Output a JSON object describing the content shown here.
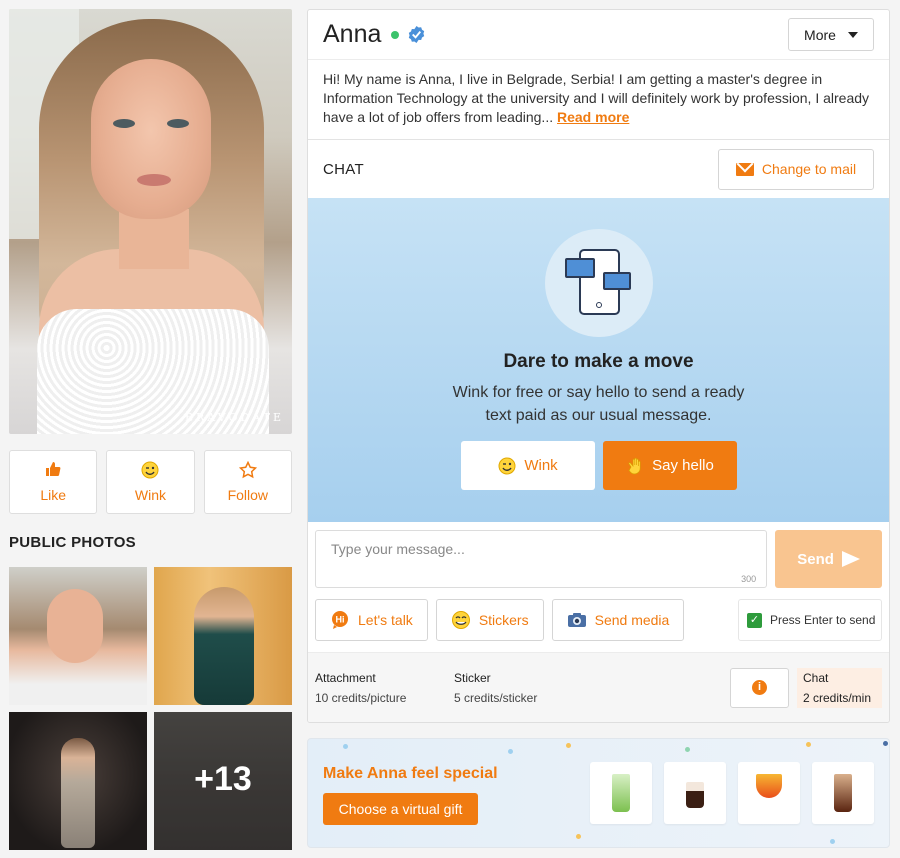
{
  "profile": {
    "name": "Anna",
    "watermark": "BRAVODATE",
    "more_label": "More",
    "bio": "Hi! My name is Anna, I live in Belgrade, Serbia! I am getting a master's degree in Information Technology at the university and I will definitely work by profession, I already have a lot of job offers from leading...",
    "read_more": "Read more"
  },
  "actions": [
    {
      "label": "Like",
      "icon": "thumbs-up-icon"
    },
    {
      "label": "Wink",
      "icon": "wink-smiley-icon"
    },
    {
      "label": "Follow",
      "icon": "star-icon"
    }
  ],
  "photos": {
    "title": "PUBLIC PHOTOS",
    "more_count": "+13"
  },
  "chat": {
    "title": "CHAT",
    "change_mail": "Change to mail",
    "hero_title": "Dare to make a move",
    "hero_text": "Wink for free or say hello to send a ready text paid as our usual message.",
    "wink": "Wink",
    "say_hello": "Say hello",
    "placeholder": "Type your message...",
    "char_limit": "300",
    "send": "Send",
    "tools": [
      {
        "label": "Let's talk",
        "icon": "hi-bubble-icon"
      },
      {
        "label": "Stickers",
        "icon": "emoji-icon"
      },
      {
        "label": "Send media",
        "icon": "camera-icon"
      }
    ],
    "press_enter": "Press Enter to send",
    "press_enter_checked": true
  },
  "credits": {
    "attachment_label": "Attachment",
    "attachment_value": "10 credits/picture",
    "sticker_label": "Sticker",
    "sticker_value": "5 credits/sticker",
    "chat_label": "Chat",
    "chat_value": "2 credits/min"
  },
  "gift": {
    "title": "Make Anna feel special",
    "button": "Choose a virtual gift",
    "items": [
      "mojito-gift",
      "coffee-gift",
      "cocktail-gift",
      "cola-gift"
    ]
  },
  "colors": {
    "accent": "#f07b11",
    "online": "#3cc36b",
    "verified": "#4a90d9",
    "hero_bg": "#b3d7f0"
  }
}
